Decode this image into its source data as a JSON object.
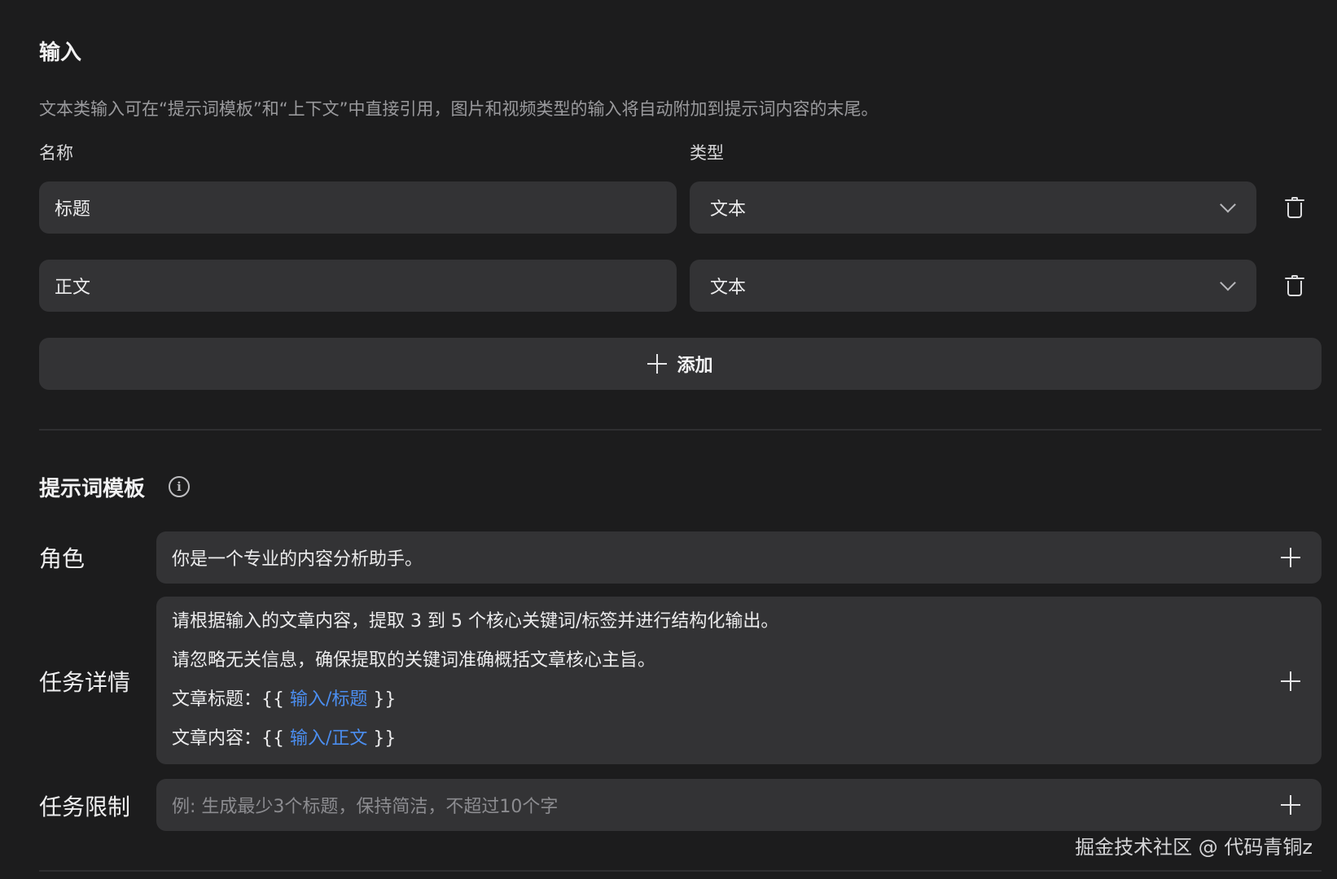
{
  "input_section": {
    "title": "输入",
    "description": "文本类输入可在“提示词模板”和“上下文”中直接引用，图片和视频类型的输入将自动附加到提示词内容的末尾。",
    "name_label": "名称",
    "type_label": "类型",
    "rows": [
      {
        "name": "标题",
        "type": "文本"
      },
      {
        "name": "正文",
        "type": "文本"
      }
    ],
    "add_label": "添加"
  },
  "prompt_section": {
    "title": "提示词模板",
    "role": {
      "label": "角色",
      "value": "你是一个专业的内容分析助手。"
    },
    "task_detail": {
      "label": "任务详情",
      "line1": "请根据输入的文章内容，提取 3 到 5 个核心关键词/标签并进行结构化输出。",
      "line2": "请忽略无关信息，确保提取的关键词准确概括文章核心主旨。",
      "line3_prefix": "文章标题：{{ ",
      "line3_ref": "输入/标题",
      "line3_suffix": " }}",
      "line4_prefix": "文章内容：{{ ",
      "line4_ref": "输入/正文",
      "line4_suffix": " }}"
    },
    "task_limit": {
      "label": "任务限制",
      "placeholder": "例: 生成最少3个标题，保持简洁，不超过10个字"
    }
  },
  "watermark": "掘金技术社区 @ 代码青铜z",
  "colors": {
    "background": "#1c1c1d",
    "field": "#333335",
    "reference_link": "#4b8ef0"
  },
  "icons": [
    "chevron-down-icon",
    "trash-icon",
    "plus-icon",
    "info-icon"
  ]
}
